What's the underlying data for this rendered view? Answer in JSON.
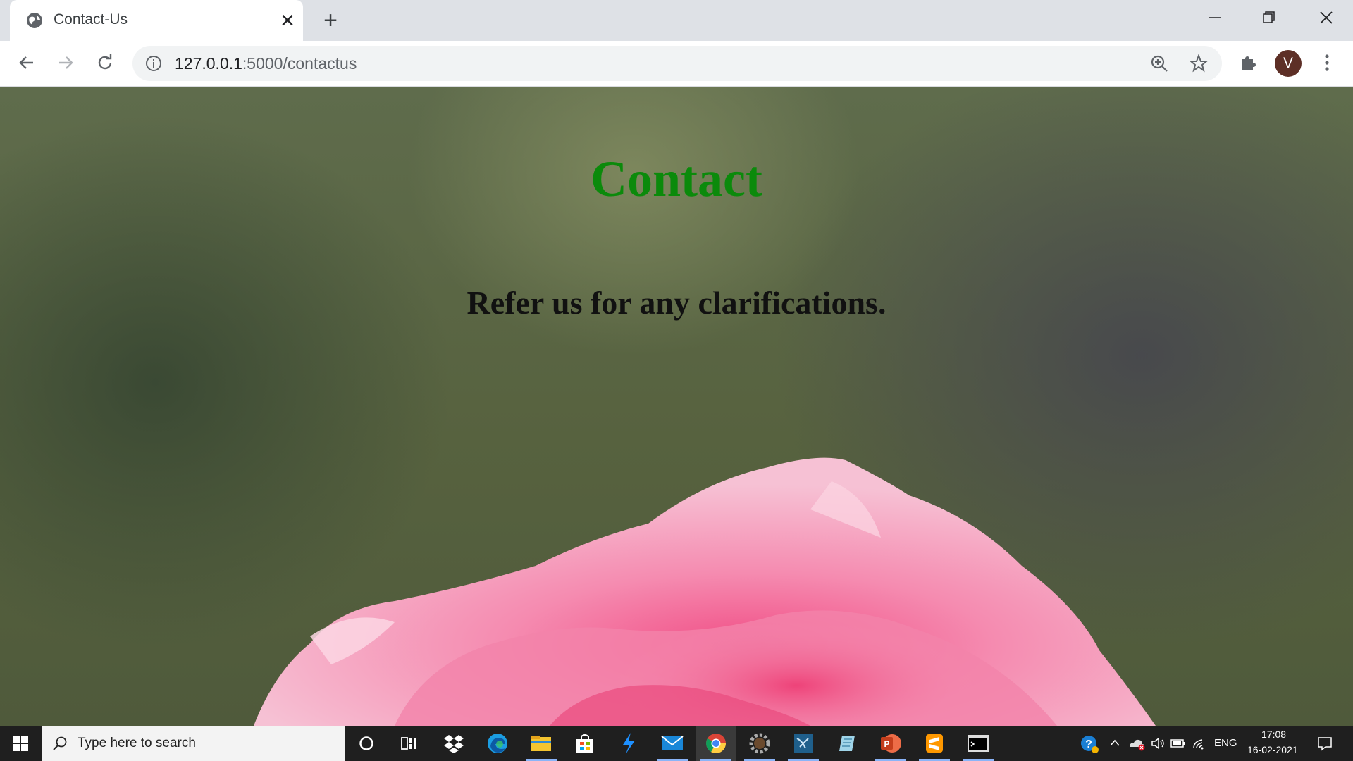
{
  "browser": {
    "tab_title": "Contact-Us",
    "close_glyph": "✕",
    "new_tab_glyph": "+",
    "url_host": "127.0.0.1",
    "url_rest": ":5000/contactus",
    "profile_initial": "V"
  },
  "page": {
    "heading": "Contact",
    "subheading": "Refer us for any clarifications."
  },
  "taskbar": {
    "search_placeholder": "Type here to search",
    "language": "ENG",
    "time": "17:08",
    "date": "16-02-2021",
    "apps": [
      "cortana-icon",
      "task-view-icon",
      "dropbox-icon",
      "edge-icon",
      "file-explorer-icon",
      "store-icon",
      "azure-data-studio-icon",
      "mail-icon",
      "chrome-icon",
      "settings-app-icon",
      "sql-tool-icon",
      "notepad-app-icon",
      "powerpoint-icon",
      "sublime-text-icon",
      "terminal-icon"
    ]
  },
  "colors": {
    "heading": "#0b8a0b",
    "subheading": "#111111",
    "rose_pink": "#f28cb0"
  }
}
